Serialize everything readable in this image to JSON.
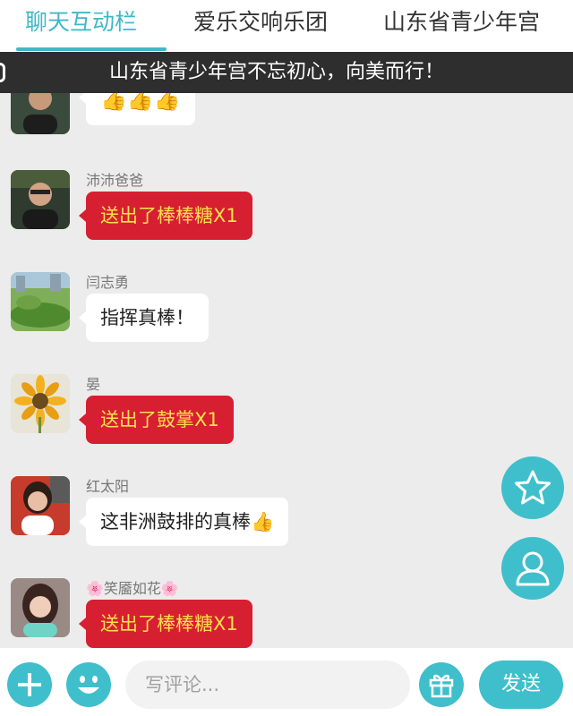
{
  "tabs": [
    {
      "label": "聊天互动栏"
    },
    {
      "label": "爱乐交响乐团"
    },
    {
      "label": "山东省青少年宫"
    }
  ],
  "marquee": {
    "text": "山东省青少年宫不忘初心，向美而行！"
  },
  "messages": [
    {
      "nickname": "",
      "type": "text",
      "content": "👍👍👍"
    },
    {
      "nickname": "沛沛爸爸",
      "type": "gift",
      "content": "送出了棒棒糖X1"
    },
    {
      "nickname": "闫志勇",
      "type": "text",
      "content": "指挥真棒！"
    },
    {
      "nickname": "晏",
      "type": "gift",
      "content": "送出了鼓掌X1"
    },
    {
      "nickname": "红太阳",
      "type": "text",
      "content": "这非洲鼓排的真棒👍"
    },
    {
      "nickname": "🌸笑靥如花🌸",
      "type": "gift",
      "content": "送出了棒棒糖X1"
    }
  ],
  "input": {
    "placeholder": "写评论..."
  },
  "send_label": "发送",
  "colors": {
    "accent": "#3fbfcb",
    "gift_bubble": "#d71f32",
    "gift_text": "#ffe14d"
  }
}
